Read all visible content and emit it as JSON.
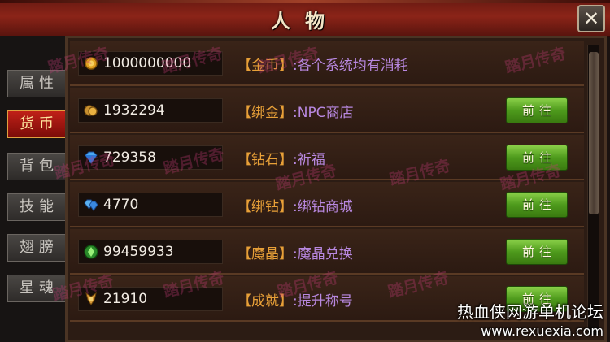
{
  "window": {
    "title": "人物",
    "close_icon": "close-x-icon"
  },
  "tabs": [
    {
      "label": "属性",
      "active": false
    },
    {
      "label": "货币",
      "active": true
    },
    {
      "label": "背包",
      "active": false
    },
    {
      "label": "技能",
      "active": false
    },
    {
      "label": "翅膀",
      "active": false
    },
    {
      "label": "星魂",
      "active": false
    }
  ],
  "currencies": [
    {
      "icon": "gold-coin-icon",
      "value": "1000000000",
      "label": "【金币】",
      "desc": ":各个系统均有消耗",
      "button": null
    },
    {
      "icon": "bound-gold-icon",
      "value": "1932294",
      "label": "【绑金】",
      "desc": ":NPC商店",
      "button": "前往"
    },
    {
      "icon": "diamond-icon",
      "value": "729358",
      "label": "【钻石】",
      "desc": ":祈福",
      "button": "前往"
    },
    {
      "icon": "bound-diamond-icon",
      "value": "4770",
      "label": "【绑钻】",
      "desc": ":绑钻商城",
      "button": "前往"
    },
    {
      "icon": "magic-crystal-icon",
      "value": "99459933",
      "label": "【魔晶】",
      "desc": ":魔晶兑换",
      "button": "前往"
    },
    {
      "icon": "achievement-icon",
      "value": "21910",
      "label": "【成就】",
      "desc": ":提升称号",
      "button": "前往"
    }
  ],
  "watermark": "踏月传奇",
  "forum_watermark": {
    "title": "热血侠网游单机论坛",
    "url": "www.rexuexia.com"
  },
  "colors": {
    "label": "#e8a038",
    "desc": "#b888e0",
    "active_tab": "#c02018",
    "button": "#4e9a1c"
  }
}
